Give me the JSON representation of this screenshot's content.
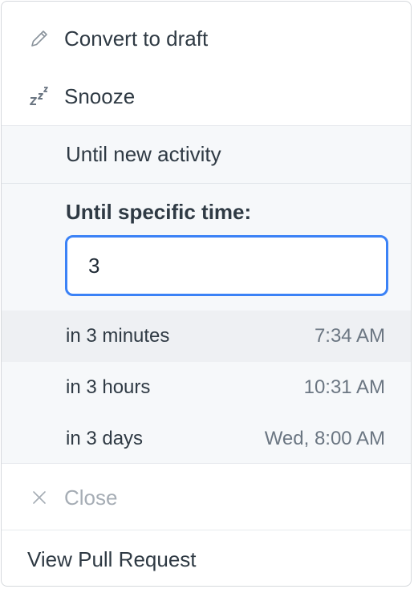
{
  "menu": {
    "convert_to_draft": {
      "label": "Convert to draft",
      "icon": "pencil-icon"
    },
    "snooze": {
      "label": "Snooze",
      "icon": "zzz-icon"
    },
    "until_new_activity": "Until new activity",
    "until_specific_time": {
      "label": "Until specific time:",
      "input_value": "3"
    },
    "suggestions": [
      {
        "label": "in 3 minutes",
        "time": "7:34 AM"
      },
      {
        "label": "in 3 hours",
        "time": "10:31 AM"
      },
      {
        "label": "in 3 days",
        "time": "Wed, 8:00 AM"
      }
    ],
    "close": {
      "label": "Close",
      "icon": "close-icon"
    },
    "view_pull_request": "View Pull Request"
  },
  "colors": {
    "accent_focus": "#3b82f6",
    "text": "#2f3a44",
    "muted": "#6b7682",
    "disabled": "#a6adb5",
    "panel_bg": "#f6f8fa",
    "highlight_bg": "#eef0f3"
  }
}
